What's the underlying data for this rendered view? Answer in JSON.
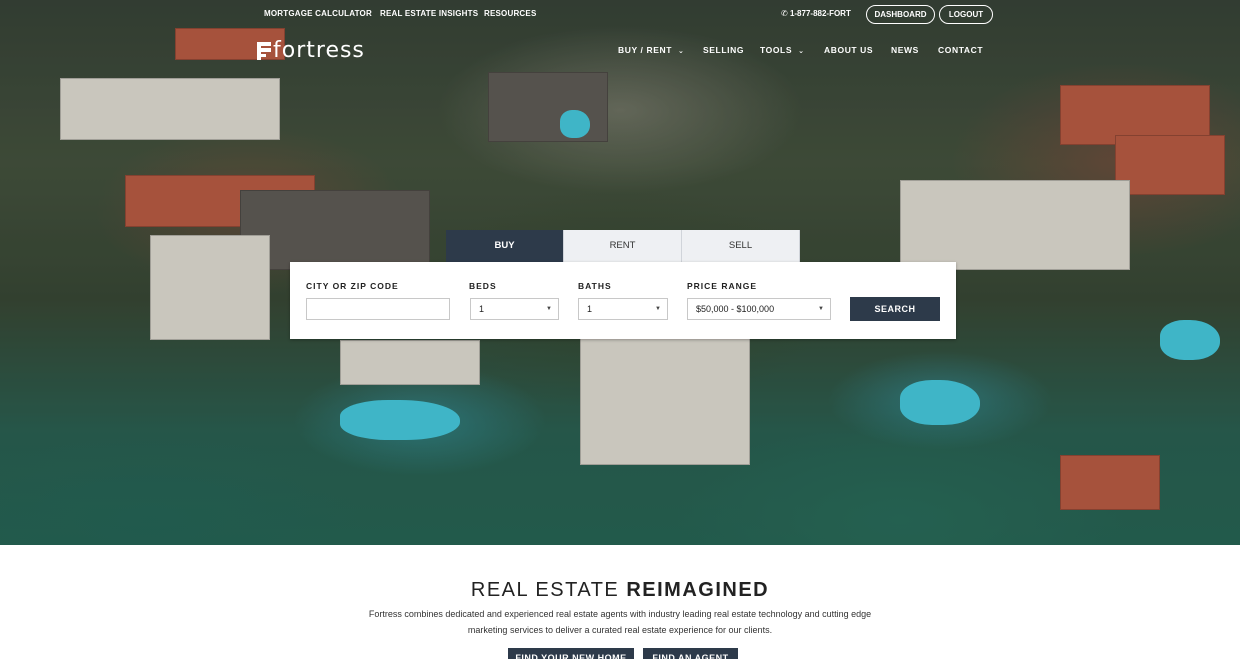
{
  "topbar": {
    "links": [
      "MORTGAGE CALCULATOR",
      "REAL ESTATE INSIGHTS",
      "RESOURCES"
    ],
    "phone": "1-877-882-FORT",
    "dashboard_label": "DASHBOARD",
    "logout_label": "LOGOUT"
  },
  "logo": {
    "text": "fortress"
  },
  "nav": {
    "items": [
      {
        "label": "BUY / RENT",
        "has_dropdown": true
      },
      {
        "label": "SELLING",
        "has_dropdown": false
      },
      {
        "label": "TOOLS",
        "has_dropdown": true
      },
      {
        "label": "ABOUT US",
        "has_dropdown": false
      },
      {
        "label": "NEWS",
        "has_dropdown": false
      },
      {
        "label": "CONTACT",
        "has_dropdown": false
      }
    ],
    "chevron": "⌄"
  },
  "search": {
    "tabs": [
      {
        "label": "BUY",
        "active": true
      },
      {
        "label": "RENT",
        "active": false
      },
      {
        "label": "SELL",
        "active": false
      }
    ],
    "city_label": "CITY OR ZIP CODE",
    "city_value": "",
    "beds_label": "BEDS",
    "beds_value": "1",
    "baths_label": "BATHS",
    "baths_value": "1",
    "price_label": "PRICE RANGE",
    "price_value": "$50,000 - $100,000",
    "search_button": "SEARCH"
  },
  "intro": {
    "headline_light": "REAL ESTATE ",
    "headline_bold": "REIMAGINED",
    "body": "Fortress combines dedicated and experienced real estate agents with industry leading real estate technology and cutting edge marketing services to deliver a curated real estate experience for our clients.",
    "cta_primary": "FIND YOUR NEW HOME",
    "cta_secondary": "FIND AN AGENT"
  },
  "colors": {
    "accent": "#2d3a4a",
    "tab_inactive": "#eef0f3"
  }
}
